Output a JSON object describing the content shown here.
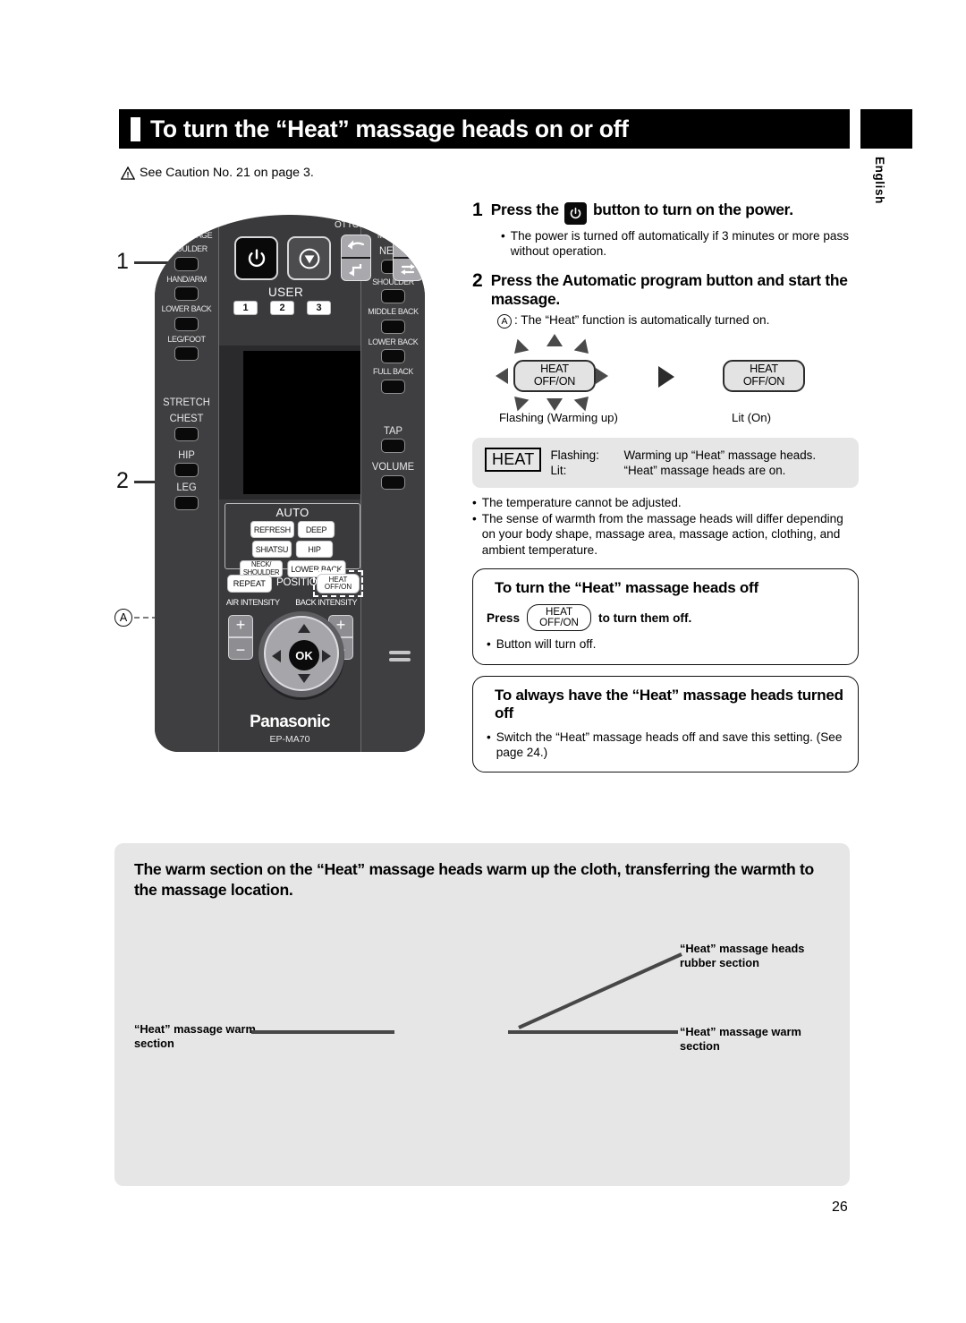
{
  "header": {
    "title": "To turn the “Heat” massage heads on or off",
    "language_tab": "English"
  },
  "caution": {
    "icon": "warning-triangle-icon",
    "text": "See Caution No. 21 on page 3."
  },
  "callouts": {
    "one": "1",
    "two": "2",
    "a": "A"
  },
  "remote": {
    "brand": "Panasonic",
    "model": "EP-MA70",
    "power_icon": "power-icon",
    "stop_icon": "stop-icon",
    "ottoman_label": "OTTOMAN",
    "chair_label": "CHAIR",
    "user_label": "USER",
    "user_buttons": [
      "1",
      "2",
      "3"
    ],
    "left_column": {
      "section1_title": "AIR MASSAGE",
      "section1_items": [
        "SHOULDER",
        "HAND/ARM",
        "LOWER BACK",
        "LEG/FOOT"
      ],
      "section2_title": "STRETCH",
      "section2_items": [
        "CHEST",
        "HIP",
        "LEG"
      ]
    },
    "right_column": {
      "title": "MANUAL",
      "items": [
        "NECK",
        "SHOULDER",
        "MIDDLE BACK",
        "LOWER BACK",
        "FULL BACK"
      ],
      "extra": [
        "TAP",
        "VOLUME"
      ]
    },
    "auto": {
      "title": "AUTO",
      "buttons": [
        "REFRESH",
        "DEEP",
        "SHIATSU",
        "HIP",
        "NECK/\nSHOULDER",
        "LOWER BACK"
      ]
    },
    "repeat_label": "REPEAT",
    "position_label": "POSITION",
    "heat_button_line1": "HEAT",
    "heat_button_line2": "OFF/ON",
    "air_intensity_label": "AIR INTENSITY",
    "back_intensity_label": "BACK INTENSITY",
    "plus": "+",
    "minus": "−",
    "ok_label": "OK"
  },
  "steps": [
    {
      "num": "1",
      "title_before": "Press the",
      "title_after": "button to turn on the power.",
      "bullets": [
        "The power is turned off automatically if 3 minutes or more pass without operation."
      ]
    },
    {
      "num": "2",
      "title": "Press the Automatic program button and start the massage.",
      "sub_marker": "A",
      "sub_text": ": The “Heat” function is automatically turned on."
    }
  ],
  "flash_diagram": {
    "left_button_line1": "HEAT",
    "left_button_line2": "OFF/ON",
    "right_button_line1": "HEAT",
    "right_button_line2": "OFF/ON",
    "left_caption": "Flashing (Warming up)",
    "right_caption": "Lit (On)"
  },
  "legend": {
    "badge": "HEAT",
    "rows": [
      {
        "key": "Flashing:",
        "value": "Warming up “Heat” massage heads."
      },
      {
        "key": "Lit:",
        "value": "“Heat” massage heads are on."
      }
    ]
  },
  "notes": [
    "The temperature cannot be adjusted.",
    "The sense of warmth from the massage heads will differ depending on your body shape, massage area, massage action, clothing, and ambient temperature."
  ],
  "card_off": {
    "heading": "To turn the “Heat” massage heads off",
    "press_word": "Press",
    "button_line1": "HEAT",
    "button_line2": "OFF/ON",
    "press_tail": "to turn them off.",
    "bullet": "Button will turn off."
  },
  "card_always_off": {
    "heading": "To always have the “Heat” massage heads turned off",
    "bullet": "Switch the “Heat” massage heads off and save this setting. (See page 24.)"
  },
  "bottom_panel": {
    "title": "The warm section on the “Heat” massage heads warm up the cloth, transferring the warmth to the massage location.",
    "label_rubber": "“Heat” massage heads rubber section",
    "label_warm_left": "“Heat” massage warm section",
    "label_warm_right": "“Heat” massage warm section"
  },
  "page_number": "26"
}
